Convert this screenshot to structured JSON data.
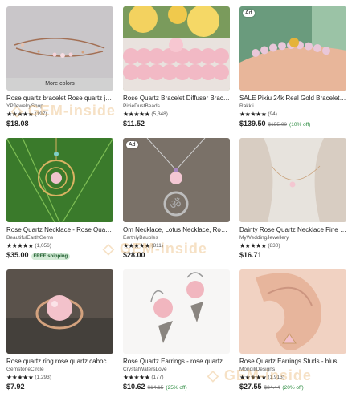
{
  "products": [
    {
      "title": "Rose quartz bracelet Rose quartz je...",
      "shop": "YPJewelryShop",
      "stars": "★★★★★",
      "count": "(197)",
      "price": "$18.08",
      "more": "More colors",
      "ad": "",
      "strike": "",
      "off": "",
      "badge": "",
      "img": "bracelet-thin"
    },
    {
      "title": "Rose Quartz Bracelet Diffuser Brace...",
      "shop": "PixieDustBeads",
      "stars": "★★★★★",
      "count": "(5,348)",
      "price": "$11.52",
      "more": "",
      "ad": "",
      "strike": "",
      "off": "",
      "badge": "",
      "img": "beads-flowers"
    },
    {
      "title": "SALE Pixiu 24k Real Gold Bracelet/R...",
      "shop": "Rakkii",
      "stars": "★★★★★",
      "count": "(94)",
      "price": "$139.50",
      "more": "",
      "ad": "Ad",
      "strike": "$155.00",
      "off": "(10% off)",
      "badge": "",
      "img": "wrist"
    },
    {
      "title": "Rose Quartz Necklace - Rose Quart...",
      "shop": "BeautifulEarthGems",
      "stars": "★★★★★",
      "count": "(1,056)",
      "price": "$35.00",
      "more": "",
      "ad": "",
      "strike": "",
      "off": "",
      "badge": "FREE shipping",
      "img": "leaf-pendant"
    },
    {
      "title": "Om Necklace, Lotus Necklace, Rose...",
      "shop": "EarthlyBaubles",
      "stars": "★★★★★",
      "count": "(811)",
      "price": "$28.00",
      "more": "",
      "ad": "Ad",
      "strike": "",
      "off": "",
      "badge": "",
      "img": "om"
    },
    {
      "title": "Dainty Rose Quartz Necklace Fine C...",
      "shop": "MyWeddingJewellery",
      "stars": "★★★★★",
      "count": "(830)",
      "price": "$16.71",
      "more": "",
      "ad": "",
      "strike": "",
      "off": "",
      "badge": "",
      "img": "neck"
    },
    {
      "title": "Rose quartz ring rose quartz caboc...",
      "shop": "GemstoneCircle",
      "stars": "★★★★★",
      "count": "(1,293)",
      "price": "$7.92",
      "more": "",
      "ad": "",
      "strike": "",
      "off": "",
      "badge": "",
      "img": "ring"
    },
    {
      "title": "Rose Quartz Earrings - rose quartz j...",
      "shop": "CrystalWatersLove",
      "stars": "★★★★★",
      "count": "(177)",
      "price": "$10.62",
      "more": "",
      "ad": "",
      "strike": "$14.15",
      "off": "(25% off)",
      "badge": "",
      "img": "earrings"
    },
    {
      "title": "Rose Quartz Earrings Studs - blush ...",
      "shop": "MondiliDesigns",
      "stars": "★★★★★",
      "count": "(1,913)",
      "price": "$27.55",
      "more": "",
      "ad": "",
      "strike": "$34.44",
      "off": "(20% off)",
      "badge": "",
      "img": "ear"
    }
  ],
  "watermark": "GEM-inside"
}
